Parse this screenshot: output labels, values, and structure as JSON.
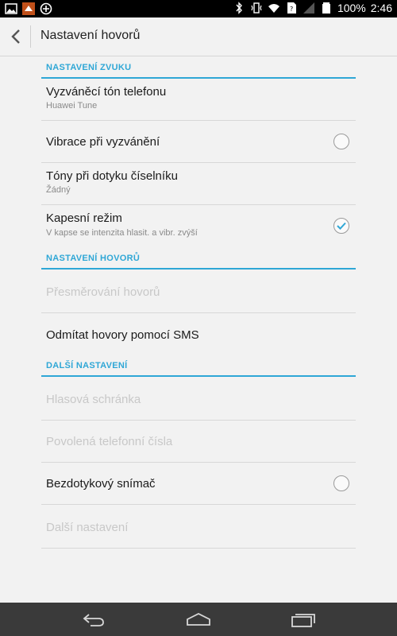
{
  "status_bar": {
    "battery": "100%",
    "time": "2:46",
    "left_icons": [
      "gallery-icon",
      "app-icon",
      "sync-icon"
    ],
    "right_icons": [
      "bluetooth-icon",
      "vibrate-icon",
      "wifi-icon",
      "sim-icon",
      "signal-icon",
      "battery-icon"
    ]
  },
  "action_bar": {
    "title": "Nastavení hovorů"
  },
  "sections": {
    "sound": {
      "header": "NASTAVENÍ ZVUKU"
    },
    "calls": {
      "header": "NASTAVENÍ HOVORŮ"
    },
    "other": {
      "header": "DALŠÍ NASTAVENÍ"
    }
  },
  "items": {
    "ringtone": {
      "title": "Vyzváněcí tón telefonu",
      "subtitle": "Huawei Tune"
    },
    "vibrate": {
      "title": "Vibrace při vyzvánění",
      "checked": false
    },
    "dial_tones": {
      "title": "Tóny při dotyku číselníku",
      "subtitle": "Žádný"
    },
    "pocket_mode": {
      "title": "Kapesní režim",
      "subtitle": "V kapse se intenzita hlasit. a vibr. zvýší",
      "checked": true
    },
    "call_forwarding": {
      "title": "Přesměrování hovorů",
      "enabled": false
    },
    "reject_sms": {
      "title": "Odmítat hovory pomocí SMS"
    },
    "voicemail": {
      "title": "Hlasová schránka",
      "enabled": false
    },
    "fdn": {
      "title": "Povolená telefonní čísla",
      "enabled": false
    },
    "proximity": {
      "title": "Bezdotykový snímač",
      "checked": false
    },
    "more": {
      "title": "Další nastavení",
      "enabled": false
    }
  },
  "colors": {
    "accent": "#2fa7d6",
    "background": "#f2f2f2",
    "navbar": "#3a3a3a"
  }
}
